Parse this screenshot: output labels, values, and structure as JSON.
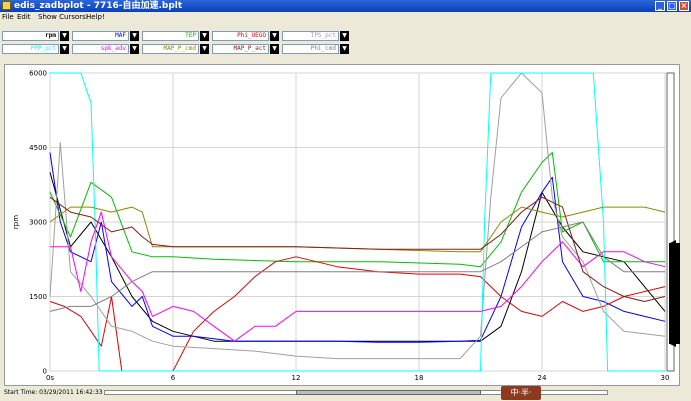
{
  "window": {
    "title": "edis_zadbplot - 7716-自由加速.bplt"
  },
  "menu": [
    "File",
    "Edit",
    "Show Cursors!",
    "Help!"
  ],
  "channels": [
    {
      "label": "rpm",
      "color": "#000000",
      "bold": true
    },
    {
      "label": "MAF",
      "color": "#0000ff"
    },
    {
      "label": "TEP",
      "color": "#00c000"
    },
    {
      "label": "Phi_UEGO",
      "color": "#e00000"
    },
    {
      "label": "TPS_pct",
      "color": "#a0a0a0"
    },
    {
      "label": "PPP_pct",
      "color": "#00ffff"
    },
    {
      "label": "spk_adv",
      "color": "#ff00ff"
    },
    {
      "label": "MAP_P_cmd",
      "color": "#8b8b00"
    },
    {
      "label": "MAP_P_act",
      "color": "#8b1a1a"
    },
    {
      "label": "Phi_cmd",
      "color": "#808080"
    }
  ],
  "chart_data": {
    "type": "line",
    "ylabel": "rpm",
    "xlim": [
      0,
      30
    ],
    "ylim": [
      0,
      6000
    ],
    "x_ticks": [
      "0s",
      "6",
      "12",
      "18",
      "24",
      "30"
    ],
    "y_ticks": [
      "0",
      "1500",
      "3000",
      "4500",
      "6000"
    ],
    "grid": true,
    "series": [
      {
        "name": "rpm",
        "color": "#000000",
        "x": [
          0,
          1,
          2,
          3,
          4,
          5,
          6,
          8,
          12,
          16,
          20,
          21,
          22,
          23,
          24,
          25,
          26,
          27,
          28,
          29,
          30
        ],
        "y": [
          4000,
          2500,
          3000,
          2300,
          1500,
          1000,
          800,
          600,
          600,
          600,
          600,
          600,
          900,
          2000,
          3600,
          2900,
          2400,
          2300,
          2200,
          1700,
          1200
        ]
      },
      {
        "name": "MAF",
        "color": "#0000ff",
        "x": [
          0,
          0.5,
          1,
          2,
          2.5,
          3,
          4,
          4.5,
          5,
          6,
          7,
          8,
          9,
          10,
          12,
          14,
          16,
          18,
          20,
          21,
          22,
          23,
          24,
          24.5,
          25,
          26,
          27,
          28,
          30
        ],
        "y": [
          4400,
          3000,
          2400,
          2200,
          3000,
          1800,
          1300,
          1500,
          900,
          700,
          700,
          650,
          600,
          600,
          600,
          600,
          580,
          580,
          600,
          620,
          1500,
          2900,
          3600,
          3900,
          2200,
          1500,
          1400,
          1200,
          1000
        ]
      },
      {
        "name": "TEP",
        "color": "#00c000",
        "x": [
          0,
          1,
          2,
          3,
          4,
          5,
          6,
          8,
          12,
          16,
          20,
          21,
          22,
          23,
          24,
          24.5,
          25,
          26,
          27,
          28,
          30
        ],
        "y": [
          3600,
          2700,
          3800,
          3500,
          2400,
          2300,
          2300,
          2250,
          2200,
          2200,
          2150,
          2100,
          2600,
          3600,
          4200,
          4400,
          2800,
          3000,
          2200,
          2200,
          2200
        ]
      },
      {
        "name": "Phi_UEGO",
        "color": "#e00000",
        "x": [
          0,
          0.7,
          1.5,
          2.5,
          3,
          3.5,
          4,
          4.5,
          5,
          6,
          7,
          8,
          9,
          10,
          11,
          12,
          13,
          14,
          16,
          18,
          20,
          21,
          22,
          23,
          24,
          25,
          26,
          27,
          28,
          30
        ],
        "y": [
          1400,
          1300,
          1100,
          500,
          1500,
          0,
          0,
          0,
          0,
          0,
          800,
          1200,
          1500,
          1900,
          2200,
          2300,
          2200,
          2100,
          2000,
          1950,
          1950,
          1900,
          1500,
          1200,
          1100,
          1400,
          1200,
          1300,
          1500,
          1700
        ]
      },
      {
        "name": "TPS_pct",
        "color": "#a0a0a0",
        "x": [
          0,
          0.5,
          1,
          2,
          3,
          4,
          5,
          6,
          8,
          10,
          12,
          14,
          16,
          18,
          20,
          21,
          21.5,
          22,
          23,
          24,
          24.5,
          25,
          26,
          27,
          28,
          30
        ],
        "y": [
          1500,
          4600,
          2000,
          1500,
          900,
          800,
          600,
          500,
          450,
          400,
          300,
          250,
          250,
          250,
          250,
          700,
          3500,
          5500,
          6000,
          5600,
          3500,
          2700,
          2200,
          1200,
          800,
          700
        ]
      },
      {
        "name": "PPP_pct",
        "color": "#00ffff",
        "x": [
          0,
          1.5,
          2,
          2.2,
          2.4,
          21,
          21.2,
          21.5,
          22,
          25,
          26,
          26.5,
          27,
          27.2,
          30
        ],
        "y": [
          6000,
          6000,
          5400,
          3000,
          0,
          0,
          3000,
          6000,
          6000,
          6000,
          6000,
          6000,
          3000,
          0,
          0
        ]
      },
      {
        "name": "spk_adv",
        "color": "#ff00ff",
        "x": [
          0,
          1,
          1.5,
          2,
          2.5,
          3,
          4,
          4.5,
          5,
          6,
          7,
          8,
          9,
          10,
          11,
          12,
          16,
          20,
          21,
          22,
          23,
          24,
          25,
          26,
          27,
          28,
          29,
          30
        ],
        "y": [
          2500,
          2500,
          1600,
          2600,
          3200,
          2300,
          1800,
          1600,
          1100,
          1300,
          1200,
          900,
          600,
          900,
          900,
          1200,
          1200,
          1200,
          1200,
          1300,
          1700,
          2200,
          2600,
          2100,
          2400,
          2400,
          2200,
          2100
        ]
      },
      {
        "name": "MAP_P_cmd",
        "color": "#8b8b00",
        "x": [
          0,
          1,
          2,
          3,
          4,
          4.5,
          5,
          6,
          12,
          20,
          21,
          22,
          23,
          24,
          25,
          26,
          27,
          28,
          29,
          30
        ],
        "y": [
          3000,
          3300,
          3300,
          3200,
          3300,
          3200,
          2500,
          2500,
          2500,
          2400,
          2400,
          3000,
          3300,
          3200,
          3100,
          3200,
          3300,
          3300,
          3300,
          3200
        ]
      },
      {
        "name": "MAP_P_act",
        "color": "#8b1a1a",
        "x": [
          0,
          1,
          2,
          3,
          4,
          4.5,
          5,
          6,
          8,
          12,
          16,
          20,
          21,
          22,
          23,
          24,
          25,
          26,
          27,
          28,
          29,
          30
        ],
        "y": [
          3500,
          3200,
          3100,
          2800,
          2900,
          2700,
          2550,
          2500,
          2500,
          2500,
          2450,
          2450,
          2450,
          2750,
          3200,
          3500,
          3300,
          2000,
          1700,
          1500,
          1400,
          1500
        ]
      },
      {
        "name": "Phi_cmd",
        "color": "#808080",
        "x": [
          0,
          1,
          2,
          3,
          4,
          5,
          6,
          8,
          12,
          16,
          20,
          21,
          22,
          24,
          26,
          27,
          28,
          30
        ],
        "y": [
          1200,
          1300,
          1300,
          1500,
          1800,
          2000,
          2000,
          2000,
          2000,
          2000,
          2000,
          2000,
          2200,
          2800,
          3000,
          2300,
          2000,
          2000
        ]
      }
    ]
  },
  "status": {
    "start_time": "Start Time: 03/29/2011 16:42:33"
  },
  "time_slider": {
    "window_start": 12,
    "window_end": 21
  },
  "ime": {
    "label": "中·半·"
  }
}
